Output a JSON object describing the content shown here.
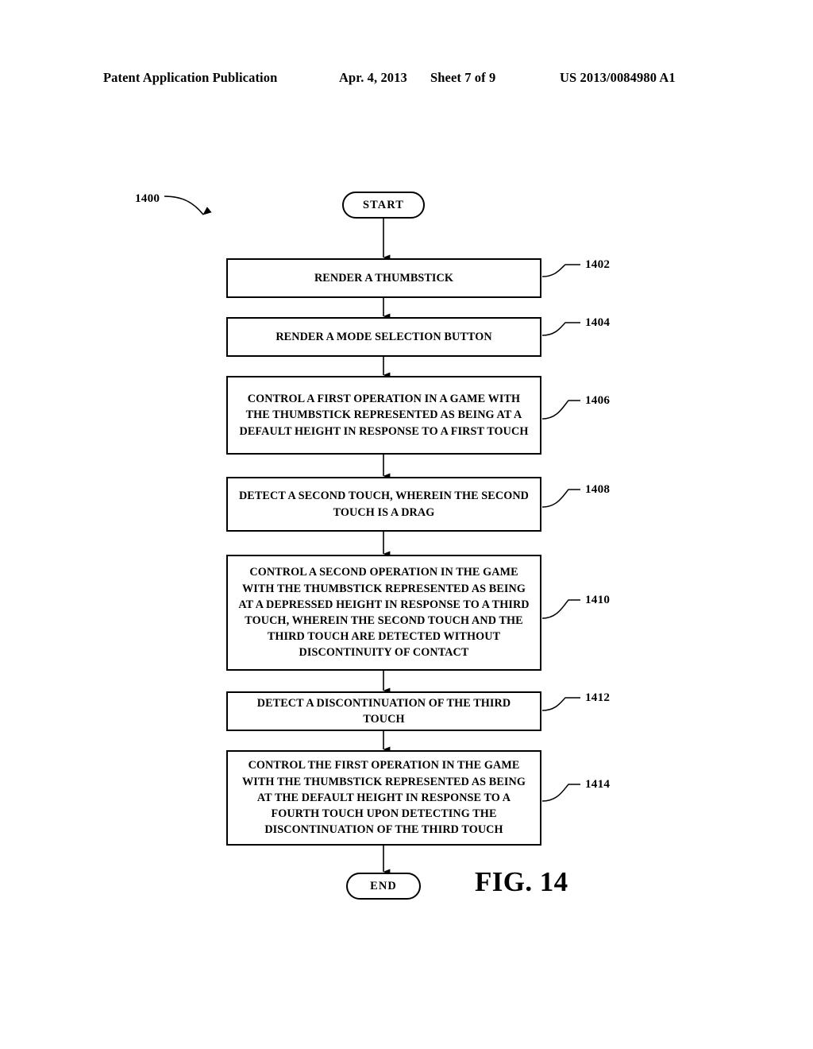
{
  "header": {
    "publication": "Patent Application Publication",
    "date": "Apr. 4, 2013",
    "sheet": "Sheet 7 of 9",
    "patent_number": "US 2013/0084980 A1"
  },
  "figure": {
    "caption": "FIG. 14",
    "flow_label": "1400"
  },
  "flowchart": {
    "start_label": "START",
    "end_label": "END",
    "steps": [
      {
        "ref": "1402",
        "text": "RENDER A THUMBSTICK"
      },
      {
        "ref": "1404",
        "text": "RENDER A MODE SELECTION BUTTON"
      },
      {
        "ref": "1406",
        "text": "CONTROL A FIRST OPERATION IN A GAME WITH THE THUMBSTICK REPRESENTED AS BEING AT A DEFAULT HEIGHT IN RESPONSE TO A FIRST TOUCH"
      },
      {
        "ref": "1408",
        "text": "DETECT A SECOND TOUCH, WHEREIN THE SECOND TOUCH IS A DRAG"
      },
      {
        "ref": "1410",
        "text": "CONTROL A SECOND OPERATION IN THE GAME WITH THE THUMBSTICK REPRESENTED AS BEING AT A DEPRESSED HEIGHT IN RESPONSE TO A THIRD TOUCH, WHEREIN THE SECOND TOUCH AND THE THIRD TOUCH ARE DETECTED WITHOUT DISCONTINUITY OF CONTACT"
      },
      {
        "ref": "1412",
        "text": "DETECT A DISCONTINUATION OF THE THIRD TOUCH"
      },
      {
        "ref": "1414",
        "text": "CONTROL THE FIRST OPERATION IN THE GAME WITH THE THUMBSTICK REPRESENTED AS BEING AT THE DEFAULT HEIGHT IN RESPONSE TO A FOURTH TOUCH UPON DETECTING THE DISCONTINUATION OF THE THIRD TOUCH"
      }
    ]
  },
  "colors": {
    "ink": "#000000",
    "paper": "#ffffff"
  }
}
